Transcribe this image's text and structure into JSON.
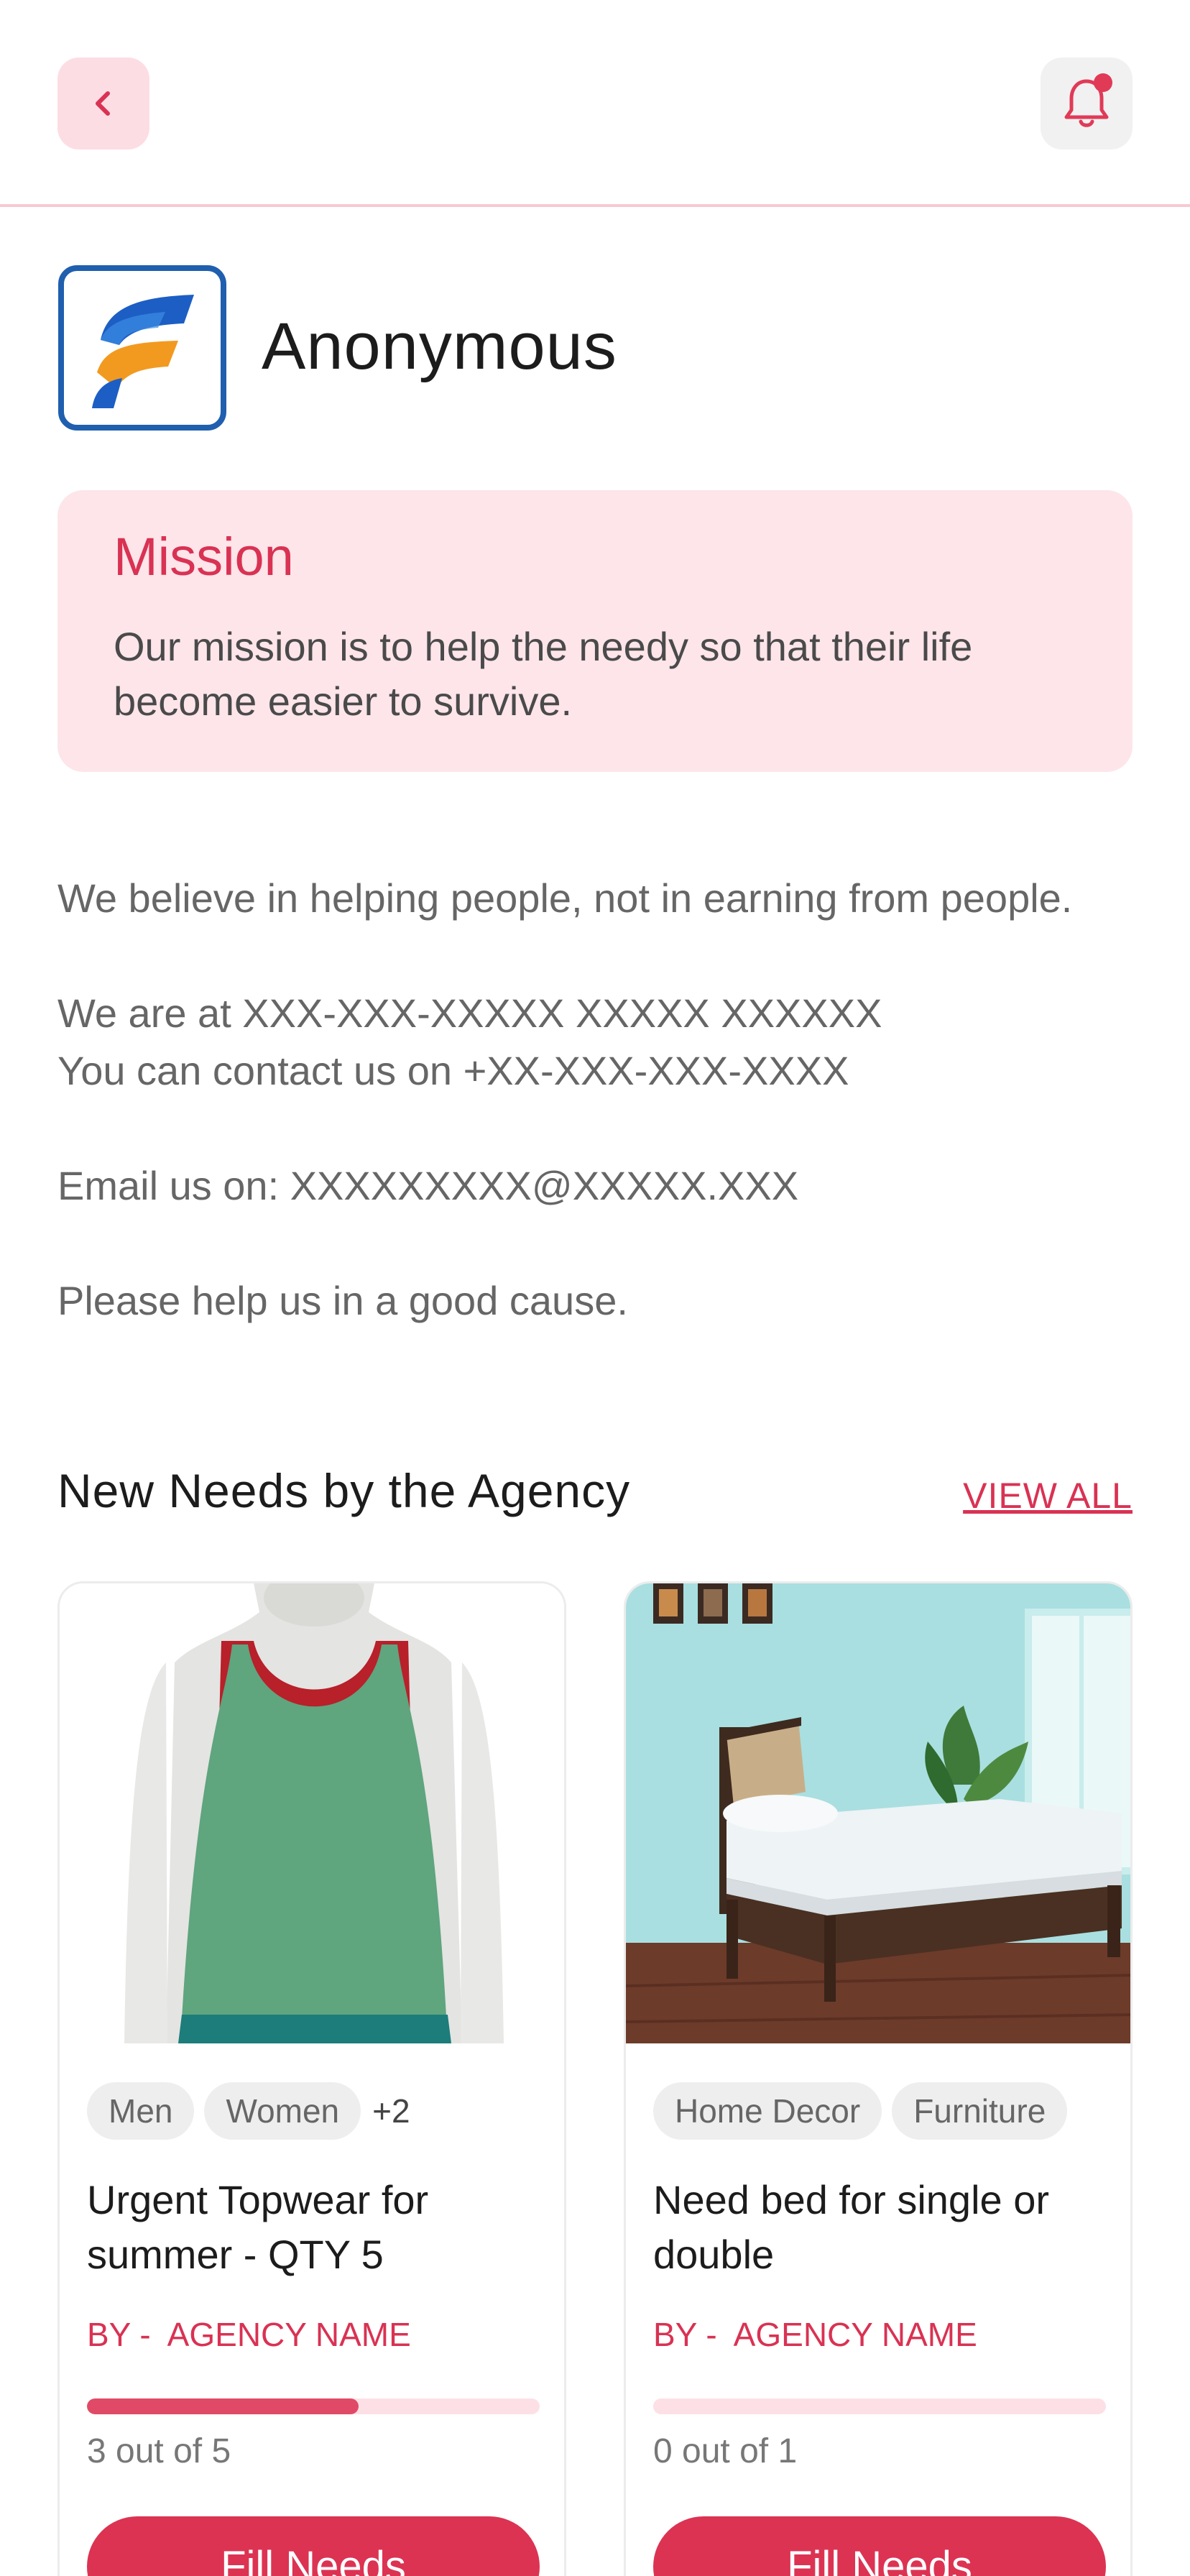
{
  "header": {
    "back_icon": "chevron-left-icon",
    "bell_icon": "bell-icon",
    "accent": "#e03a57"
  },
  "agency": {
    "name": "Anonymous",
    "logo_icon": "agency-logo"
  },
  "mission": {
    "title": "Mission",
    "text": "Our mission is to help the needy so that their life become easier to survive."
  },
  "about": {
    "line1": "We believe in helping people, not in earning from people.",
    "line2": "We are at XXX-XXX-XXXXX XXXXX XXXXXX",
    "line3": "You can contact us on +XX-XXX-XXX-XXXX",
    "line4": "Email us on: XXXXXXXXX@XXXXX.XXX",
    "line5": "Please help us in a good cause."
  },
  "needs_section": {
    "title": "New Needs by the Agency",
    "view_all": "VIEW ALL"
  },
  "needs": [
    {
      "image": "green-tank-top-on-mannequin",
      "tags": [
        "Men",
        "Women"
      ],
      "more_tags": "+2",
      "title": "Urgent Topwear for summer - QTY 5",
      "by_label": "BY -",
      "agency_name": "AGENCY NAME",
      "progress_fraction": 0.6,
      "progress_text": "3 out of 5",
      "button": "Fill Needs"
    },
    {
      "image": "single-bed-in-room",
      "tags": [
        "Home Decor",
        "Furniture"
      ],
      "more_tags": "",
      "title": "Need bed for single or double",
      "by_label": "BY -",
      "agency_name": "AGENCY NAME",
      "progress_fraction": 0,
      "progress_text": "0 out of 1",
      "button": "Fill Needs"
    }
  ]
}
